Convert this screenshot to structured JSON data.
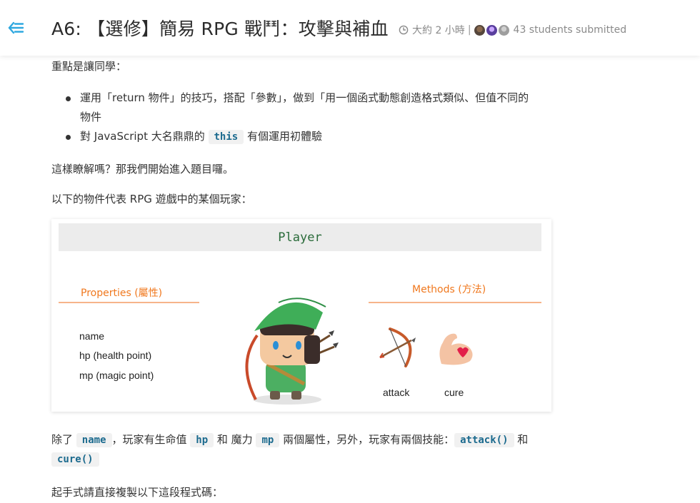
{
  "header": {
    "title": "A6: 【選修】簡易 RPG 戰鬥：攻擊與補血",
    "time": "大約 2 小時",
    "separator": "|",
    "submitted": "43 students submitted"
  },
  "content": {
    "intro": "重點是讓同學：",
    "bullets": [
      {
        "line1": "運用「return 物件」的技巧，搭配「參數」，做到「用一個函式動態創造格式類似、但值不同的",
        "line2": "物件"
      },
      {
        "prefix": "對 JavaScript 大名鼎鼎的 ",
        "code": "this",
        "suffix": " 有個運用初體驗"
      }
    ],
    "question": "這樣瞭解嗎？那我們開始進入題目囉。",
    "player_intro": "以下的物件代表 RPG 遊戲中的某個玩家：",
    "card": {
      "title": "Player",
      "properties_title": "Properties (屬性)",
      "properties": [
        "name",
        "hp (health point)",
        "mp (magic point)"
      ],
      "methods_title": "Methods (方法)",
      "methods": [
        "attack",
        "cure"
      ]
    },
    "desc": {
      "t1": "除了 ",
      "c1": "name",
      "t2": "，玩家有生命值 ",
      "c2": "hp",
      "t3": " 和 魔力 ",
      "c3": "mp",
      "t4": " 兩個屬性，另外，玩家有兩個技能：",
      "c4": "attack()",
      "t5": " 和",
      "c5": "cure()"
    },
    "last": "起手式請直接複製以下這段程式碼："
  },
  "colors": {
    "accent_blue": "#2fa8e0",
    "orange": "#f0781e",
    "code_text": "#1b6a8e",
    "code_bg": "#f1f1f1"
  },
  "icons": [
    "back-arrow-icon",
    "clock-icon",
    "bow-arrow-icon",
    "flexed-arm-heart-icon"
  ]
}
